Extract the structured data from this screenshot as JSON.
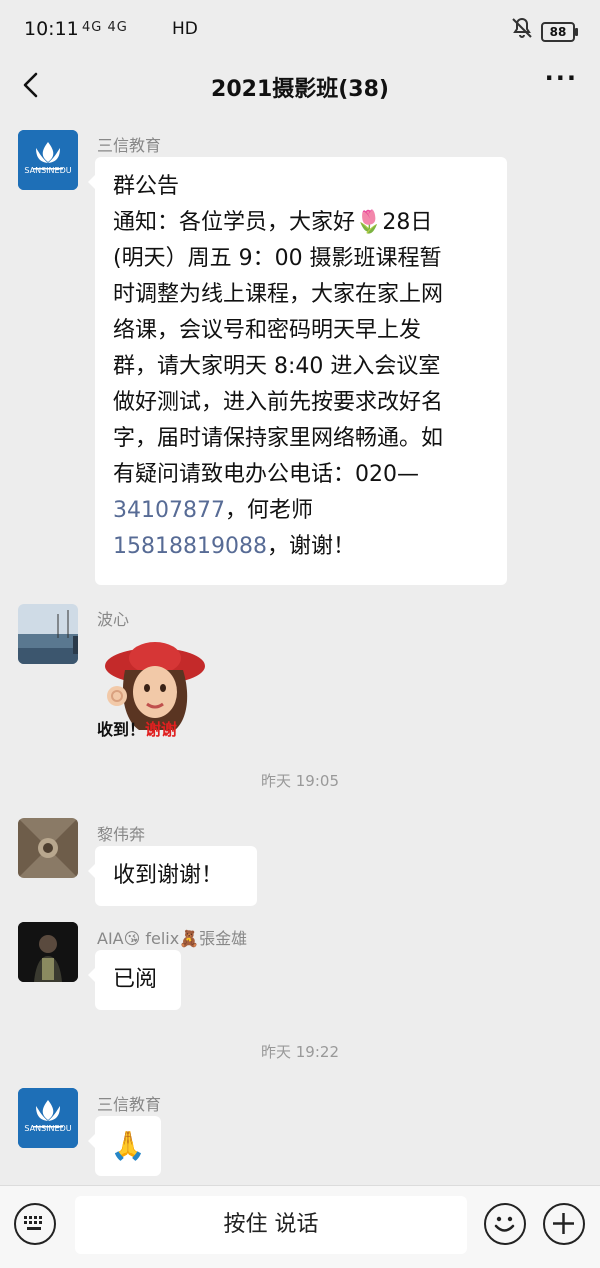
{
  "status_bar": {
    "time": "10:11",
    "network": "4G 4G",
    "hd": "HD",
    "battery": "88"
  },
  "nav": {
    "title": "2021摄影班(38)",
    "more": "···"
  },
  "messages": [
    {
      "sender": "三信教育",
      "avatar_label": "SANSINEDU",
      "announcement_title": "群公告",
      "text_1": "通知：各位学员，大家好🌷28日",
      "text_2": "(明天）周五 9：00 摄影班课程暂",
      "text_3": "时调整为线上课程，大家在家上网",
      "text_4": "络课，会议号和密码明天早上发",
      "text_5": "群，请大家明天 8:40 进入会议室",
      "text_6": "做好测试，进入前先按要求改好名",
      "text_7": "字，届时请保持家里网络畅通。如",
      "text_8": "有疑问请致电办公电话：020—",
      "phone_1": "34107877",
      "text_9": "，何老师",
      "phone_2": "15818819088",
      "text_10": "，谢谢！"
    },
    {
      "sender": "波心",
      "sticker_caption_1": "收到！",
      "sticker_caption_2": "谢谢"
    },
    {
      "timestamp": "昨天 19:05"
    },
    {
      "sender": "黎伟奔",
      "text": "收到谢谢！"
    },
    {
      "sender": "AIA😘 felix🧸張金雄",
      "text": "已阅"
    },
    {
      "timestamp": "昨天 19:22"
    },
    {
      "sender": "三信教育",
      "avatar_label": "SANSINEDU",
      "text": "🙏"
    }
  ],
  "input_bar": {
    "talk_label": "按住 说话"
  }
}
